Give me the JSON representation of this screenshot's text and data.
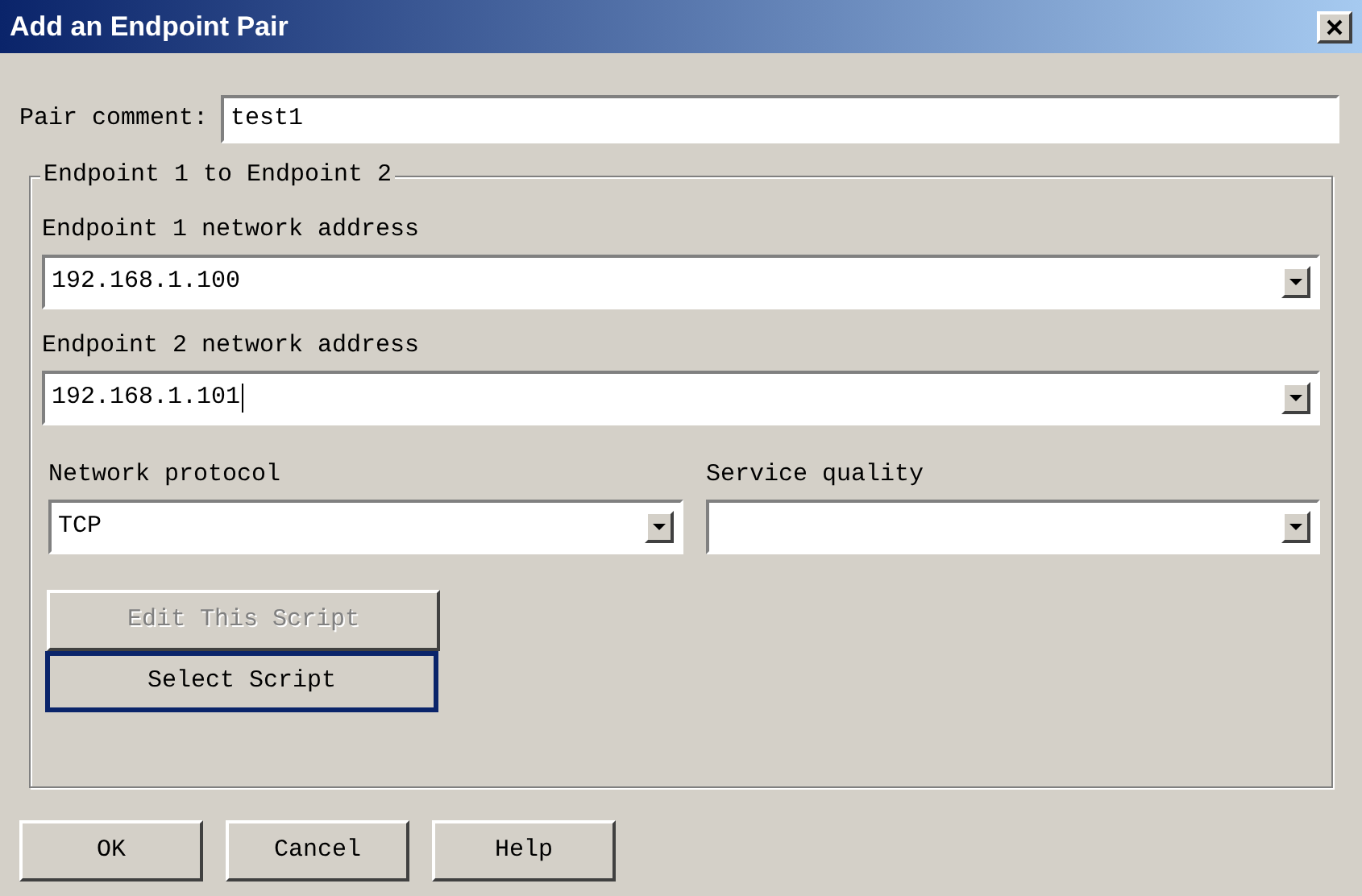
{
  "window": {
    "title": "Add an Endpoint Pair"
  },
  "pair_comment": {
    "label": "Pair comment:",
    "value": "test1"
  },
  "group": {
    "title": "Endpoint 1 to Endpoint 2",
    "endpoint1": {
      "label": "Endpoint 1 network address",
      "value": "192.168.1.100",
      "focused": false
    },
    "endpoint2": {
      "label": "Endpoint 2 network address",
      "value": "192.168.1.101",
      "focused": true
    },
    "protocol": {
      "label": "Network protocol",
      "value": "TCP"
    },
    "service_quality": {
      "label": "Service quality"
    },
    "buttons": [
      {
        "label": "Edit This Script",
        "disabled": true,
        "focused": false
      },
      {
        "label": "Select Script",
        "disabled": false,
        "focused": true
      }
    ]
  },
  "footer_buttons": [
    {
      "label": "OK"
    },
    {
      "label": "Cancel"
    },
    {
      "label": "Help"
    }
  ]
}
